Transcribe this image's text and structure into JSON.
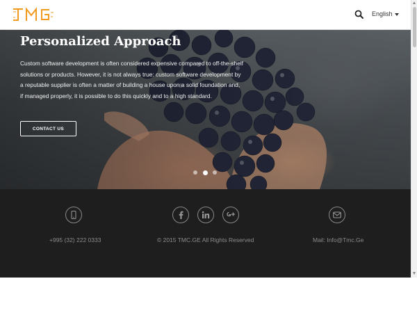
{
  "header": {
    "logo_text": "TMC",
    "language_label": "English",
    "icons": {
      "search": "search-icon",
      "caret": "caret-down-icon"
    }
  },
  "hero": {
    "title": "Personalized Approach",
    "body": "Custom software development is often considered expensive compared to off-the-shelf solutions or products. However, it is not always true: custom software development by a reputable supplier is often a matter of building a house upon a solid foundation and, if managed properly, it is possible to do this quickly and to a high standard.",
    "cta_label": "CONTACT US",
    "slides_total": 3,
    "active_slide": 2
  },
  "footer": {
    "phone": "+995 (32) 222 0333",
    "copyright": "© 2015 TMC.GE All Rights Reserved",
    "mail": "Mail: Info@Tmc.Ge",
    "icons": [
      "mobile-icon",
      "facebook-icon",
      "linkedin-icon",
      "google-plus-icon",
      "envelope-icon"
    ]
  },
  "colors": {
    "brand_orange": "#f29a1e",
    "footer_bg": "#1e1e1e",
    "footer_text": "#8c8c8c"
  }
}
